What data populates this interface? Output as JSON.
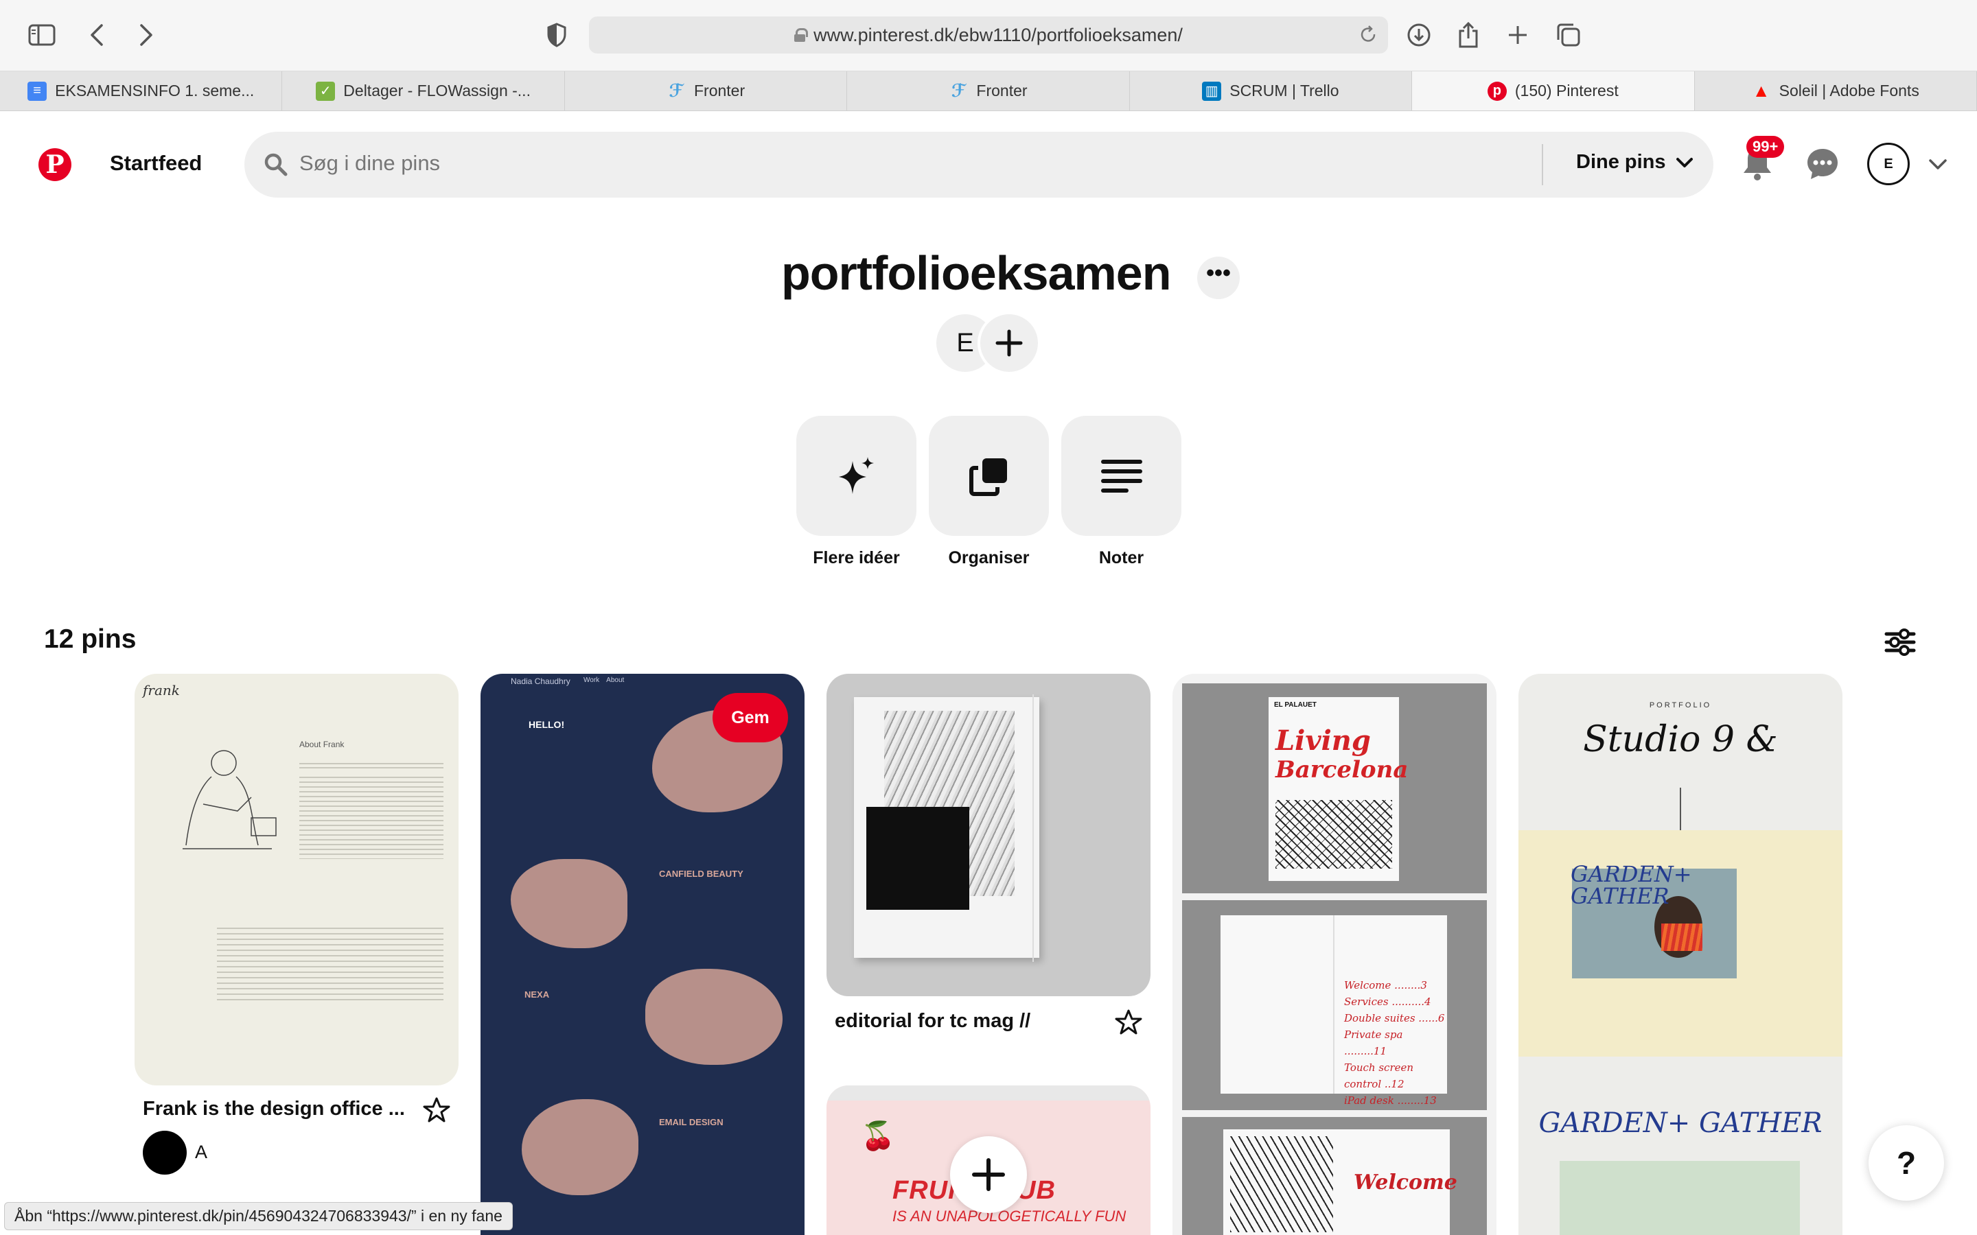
{
  "browser": {
    "url": "www.pinterest.dk/ebw1110/portfolioeksamen/",
    "tabs": [
      {
        "label": "EKSAMENSINFO 1. seme...",
        "favicon": "docs-icon",
        "color": "#4285f4"
      },
      {
        "label": "Deltager - FLOWassign -...",
        "favicon": "flow-icon",
        "color": "#7cb342"
      },
      {
        "label": "Fronter",
        "favicon": "fronter-icon",
        "color": "#4aa3df"
      },
      {
        "label": "Fronter",
        "favicon": "fronter-icon",
        "color": "#4aa3df"
      },
      {
        "label": "SCRUM | Trello",
        "favicon": "trello-icon",
        "color": "#0079bf"
      },
      {
        "label": "(150) Pinterest",
        "favicon": "pinterest-icon",
        "color": "#e60023"
      },
      {
        "label": "Soleil | Adobe Fonts",
        "favicon": "adobe-icon",
        "color": "#fa0f00"
      }
    ],
    "active_tab_index": 5,
    "status_text": "Åbn “https://www.pinterest.dk/pin/456904324706833943/” i en ny fane"
  },
  "header": {
    "logo": "P",
    "startfeed": "Startfeed",
    "search_placeholder": "Søg i dine pins",
    "scope_label": "Dine pins",
    "notification_badge": "99+",
    "account_initial": "E"
  },
  "board": {
    "title": "portfolioeksamen",
    "more": "•••",
    "collaborator_initial": "E",
    "actions": [
      {
        "label": "Flere idéer",
        "icon": "sparkle-icon"
      },
      {
        "label": "Organiser",
        "icon": "organize-icon"
      },
      {
        "label": "Noter",
        "icon": "notes-icon"
      }
    ],
    "pin_count": "12 pins"
  },
  "pins": [
    {
      "title": "Frank is the design office ...",
      "author_initial": "A",
      "image": "frank-portfolio"
    },
    {
      "title": "",
      "save_label": "Gem",
      "image": "nadia-chaudhry-portfolio"
    },
    {
      "title": "editorial for tc mag //",
      "image": "editorial-magazine"
    },
    {
      "title": "",
      "image": "living-barcelona"
    },
    {
      "title": "",
      "image": "studio-9-garden-gather"
    },
    {
      "title": "",
      "image": "fruit-club"
    }
  ],
  "pin_text": {
    "frank_logo": "frank",
    "frank_about": "About Frank",
    "nadia_name": "Nadia Chaudhry",
    "nadia_nav": [
      "Work",
      "About"
    ],
    "nadia_hello": "HELLO!",
    "nadia_sections": [
      "CANFIELD BEAUTY",
      "NEXA",
      "EMAIL DESIGN"
    ],
    "living_line1": "Living",
    "living_line2": "Barcelona",
    "living_tag": "EL PALAUET",
    "welcome_word": "Welcome",
    "toc": [
      "Welcome ........3",
      "Services ..........4",
      "Double suites ......6",
      "Private spa .........11",
      "Touch screen control ..12",
      "iPad desk ........13"
    ],
    "studio_label": "PORTFOLIO",
    "studio_script": "Studio 9 &",
    "garden_word": "GARDEN+ GATHER",
    "fruit_line1": "FRUIT   CLUB",
    "fruit_line2": "IS AN UNAPOLOGETICALLY FUN"
  },
  "help_label": "?",
  "colors": {
    "brand": "#e60023",
    "nadia_bg": "#1f2d4f",
    "nadia_blob": "#b7908a",
    "frank_bg": "#efeee4",
    "garden_bg": "#f3ecc9"
  }
}
